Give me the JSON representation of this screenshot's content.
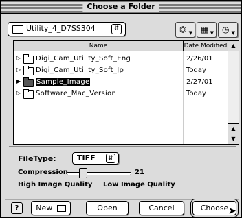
{
  "window": {
    "title": "Choose a Folder"
  },
  "location_popup": {
    "value": "Utility_4_D7SS304"
  },
  "columns": {
    "name": "Name",
    "date": "Date Modified"
  },
  "files": [
    {
      "name": "Digi_Cam_Utility_Soft_Eng",
      "date": "2/26/01",
      "selected": false
    },
    {
      "name": "Digi_Cam_Utility_Soft_Jp",
      "date": "Today",
      "selected": false
    },
    {
      "name": "Sample_Image",
      "date": "2/27/01",
      "selected": true
    },
    {
      "name": "Software_Mac_Version",
      "date": "Today",
      "selected": false
    }
  ],
  "options": {
    "filetype_label": "FileType:",
    "filetype_value": "TIFF",
    "compression_label": "Compression",
    "compression_value": "21",
    "high_quality_label": "High Image Quality",
    "low_quality_label": "Low Image Quality"
  },
  "buttons": {
    "help": "?",
    "new": "New",
    "open": "Open",
    "cancel": "Cancel",
    "choose": "Choose"
  },
  "icons": {
    "help": "help-icon",
    "new_folder": "new-folder-icon",
    "cursor": "arrow-cursor-icon"
  }
}
